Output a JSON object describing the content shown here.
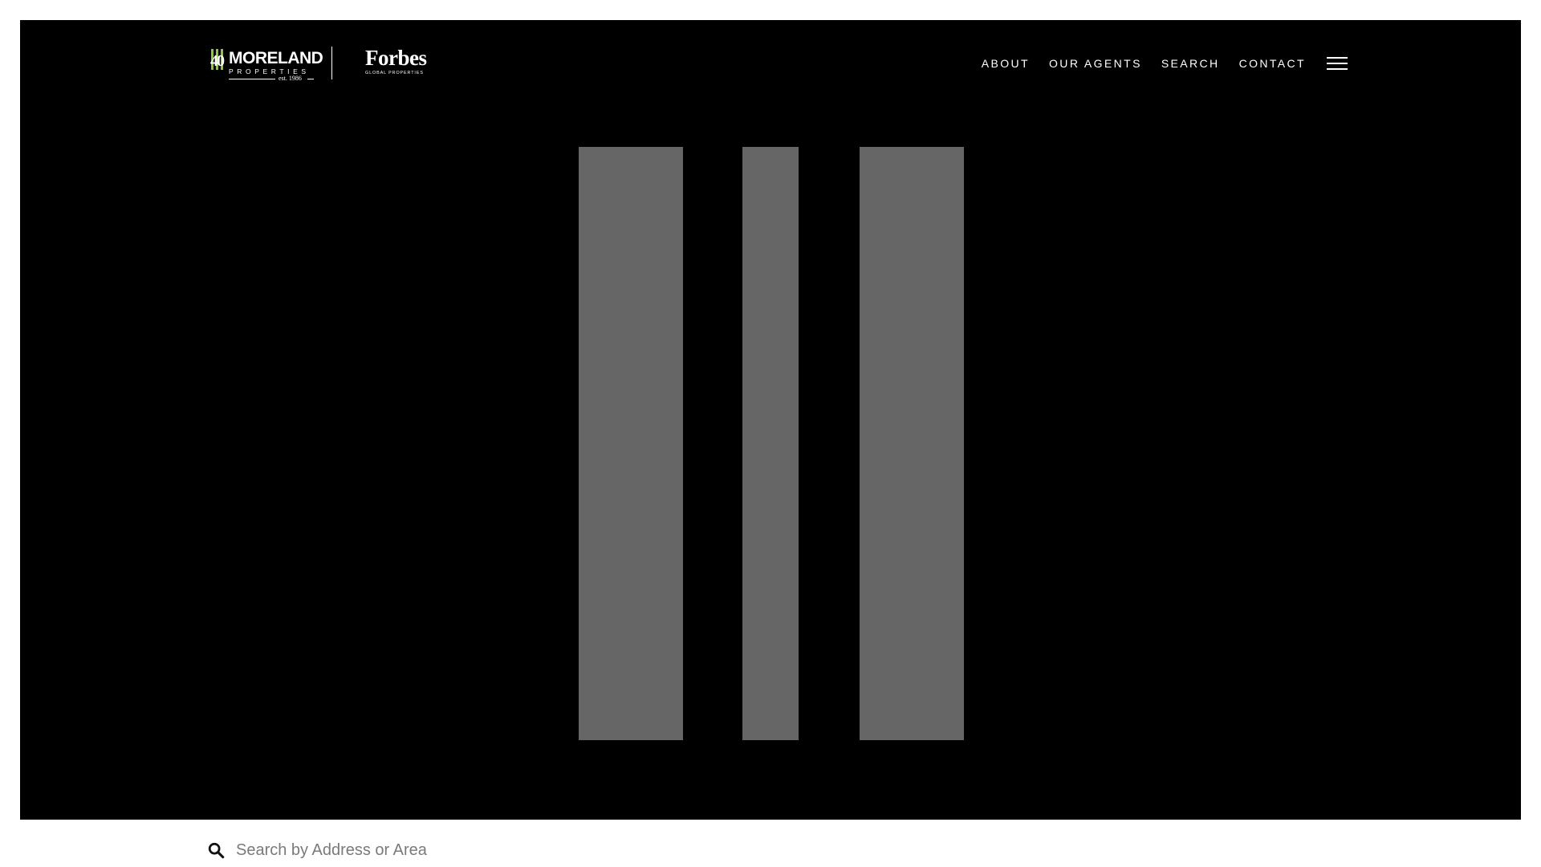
{
  "header": {
    "logo_primary": {
      "number": "40",
      "name": "MORELAND",
      "subtitle": "PROPERTIES",
      "established": "est. 1986"
    },
    "logo_secondary": {
      "name": "Forbes",
      "subtitle": "GLOBAL PROPERTIES"
    },
    "nav": [
      {
        "label": "ABOUT"
      },
      {
        "label": "OUR AGENTS"
      },
      {
        "label": "SEARCH"
      },
      {
        "label": "CONTACT"
      }
    ],
    "menu_icon": "hamburger-menu-icon"
  },
  "loader": {
    "bar_color": "#666666"
  },
  "search": {
    "icon": "search-icon",
    "placeholder": "Search by Address or Area",
    "value": ""
  },
  "colors": {
    "page_background": "#ffffff",
    "hero_background": "#000000",
    "accent_green": "#8fc63f",
    "nav_text": "#ffffff",
    "placeholder_text": "#7a7a7a"
  }
}
